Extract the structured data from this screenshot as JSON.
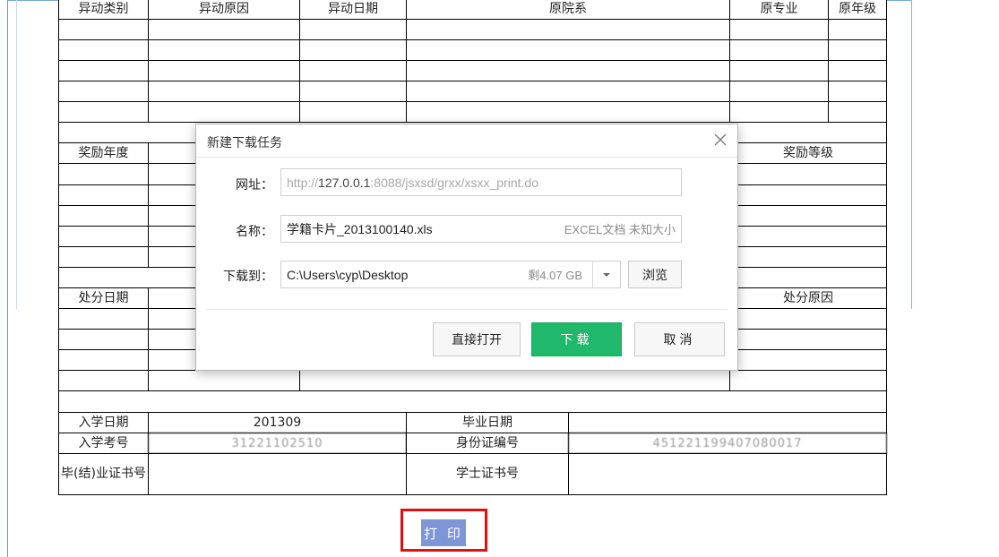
{
  "table": {
    "header": {
      "change_type": "异动类别",
      "change_reason": "异动原因",
      "change_date": "异动日期",
      "orig_college": "原院系",
      "orig_major": "原专业",
      "orig_grade": "原年级"
    },
    "award_year": "奖励年度",
    "award_level": "奖励等级",
    "punish_date": "处分日期",
    "punish_reason": "处分原因",
    "enroll_date_label": "入学日期",
    "enroll_date_value": "201309",
    "grad_date_label": "毕业日期",
    "exam_no_label": "入学考号",
    "exam_no_value": "31221102510",
    "id_no_label": "身份证编号",
    "id_no_value": "451221199407080017",
    "grad_cert_label": "毕(结)业证书号",
    "degree_cert_label": "学士证书号"
  },
  "print_button": "打 印",
  "dialog": {
    "title": "新建下载任务",
    "url_label": "网址：",
    "url_prefix": "http://",
    "url_host": "127.0.0.1",
    "url_rest": ":8088/jsxsd/grxx/xsxx_print.do",
    "name_label": "名称：",
    "file_name": "学籍卡片_2013100140.xls",
    "file_meta": "EXCEL文档 未知大小",
    "save_label": "下载到：",
    "save_path": "C:\\Users\\cyp\\Desktop",
    "free_space": "剩4.07 GB",
    "browse": "浏览",
    "open_direct": "直接打开",
    "download": "下载",
    "cancel": "取消"
  },
  "icons": [
    "close-icon",
    "chevron-down-icon"
  ],
  "colors": {
    "primary_green": "#20b86b",
    "print_button_bg": "#7e95d6",
    "highlight_red": "#e01010"
  }
}
